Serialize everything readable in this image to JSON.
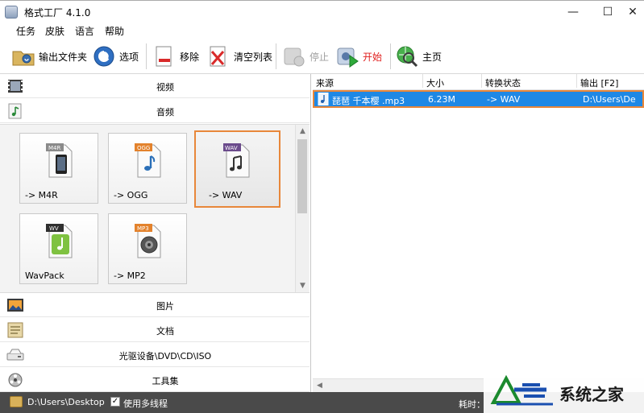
{
  "window": {
    "title": "格式工厂 4.1.0",
    "minimize": "—",
    "maximize": "☐",
    "close": "✕"
  },
  "menu": [
    "任务",
    "皮肤",
    "语言",
    "帮助"
  ],
  "toolbar": {
    "output_folder": "输出文件夹",
    "options": "选项",
    "remove": "移除",
    "clear_list": "清空列表",
    "stop": "停止",
    "start": "开始",
    "home": "主页"
  },
  "categories": {
    "video": "视频",
    "audio": "音频",
    "picture": "图片",
    "document": "文档",
    "rom": "光驱设备\\DVD\\CD\\ISO",
    "tools": "工具集"
  },
  "audio_formats": [
    {
      "badge": "M4R",
      "label": "-> M4R",
      "badge_color": "#8a8a8a"
    },
    {
      "badge": "OGG",
      "label": "-> OGG",
      "badge_color": "#e3822c"
    },
    {
      "badge": "WAV",
      "label": "-> WAV",
      "badge_color": "#6b4b8c",
      "selected": true
    },
    {
      "badge": "WV",
      "label": "WavPack",
      "badge_color": "#2f2f2f"
    },
    {
      "badge": "MP3",
      "label": "-> MP2",
      "badge_color": "#e3822c"
    }
  ],
  "task_list": {
    "columns": [
      "来源",
      "大小",
      "转换状态",
      "输出 [F2]"
    ],
    "rows": [
      {
        "source": "琵琶 千本樱 .mp3",
        "size": "6.23M",
        "status": "-> WAV",
        "output": "D:\\Users\\De"
      }
    ]
  },
  "statusbar": {
    "output_path": "D:\\Users\\Desktop",
    "multithread_label": "使用多线程",
    "multithread_checked": true,
    "checkmark": "✓",
    "elapsed_label": "耗时："
  },
  "watermark": {
    "text": "系统之家"
  },
  "colors": {
    "selection": "#1e88e5",
    "highlight": "#e8873a",
    "status_bg": "#4a4a4a",
    "start_red": "#e0201f"
  }
}
